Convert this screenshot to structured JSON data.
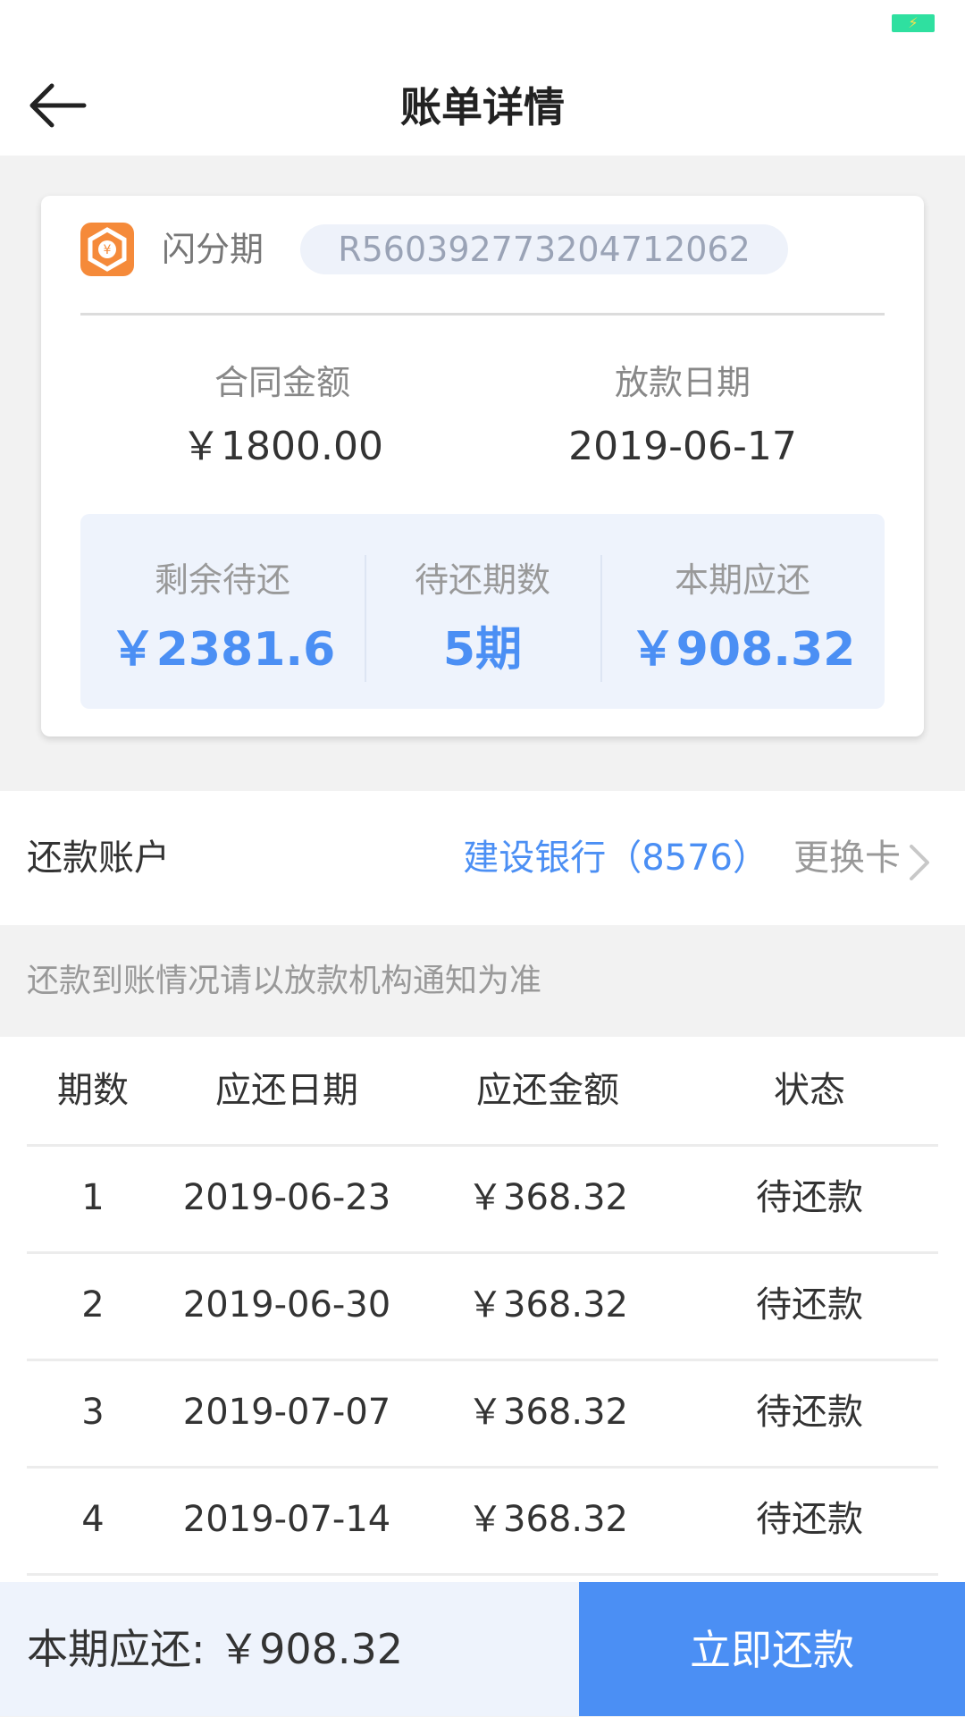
{
  "nav": {
    "title": "账单详情"
  },
  "lender": {
    "name": "闪分期",
    "contract_no": "R560392773204712062",
    "logo_color": "#f58a3a"
  },
  "contract": {
    "amount_label": "合同金额",
    "amount": "￥1800.00",
    "loan_date_label": "放款日期",
    "loan_date": "2019-06-17"
  },
  "summary": [
    {
      "label": "剩余待还",
      "value": "￥2381.6"
    },
    {
      "label": "待还期数",
      "value": "5期"
    },
    {
      "label": "本期应还",
      "value": "￥908.32"
    }
  ],
  "account": {
    "label": "还款账户",
    "bank": "建设银行（8576）",
    "change_label": "更换卡"
  },
  "notice": "还款到账情况请以放款机构通知为准",
  "schedule": {
    "headers": [
      "期数",
      "应还日期",
      "应还金额",
      "状态"
    ],
    "rows": [
      {
        "period": "1",
        "date": "2019-06-23",
        "amount": "￥368.32",
        "status": "待还款"
      },
      {
        "period": "2",
        "date": "2019-06-30",
        "amount": "￥368.32",
        "status": "待还款"
      },
      {
        "period": "3",
        "date": "2019-07-07",
        "amount": "￥368.32",
        "status": "待还款"
      },
      {
        "period": "4",
        "date": "2019-07-14",
        "amount": "￥368.32",
        "status": "待还款"
      }
    ]
  },
  "footer": {
    "due_summary": "本期应还: ￥908.32",
    "pay_button": "立即还款"
  },
  "colors": {
    "accent": "#4b8ff4",
    "battery": "#2fe0a0"
  }
}
